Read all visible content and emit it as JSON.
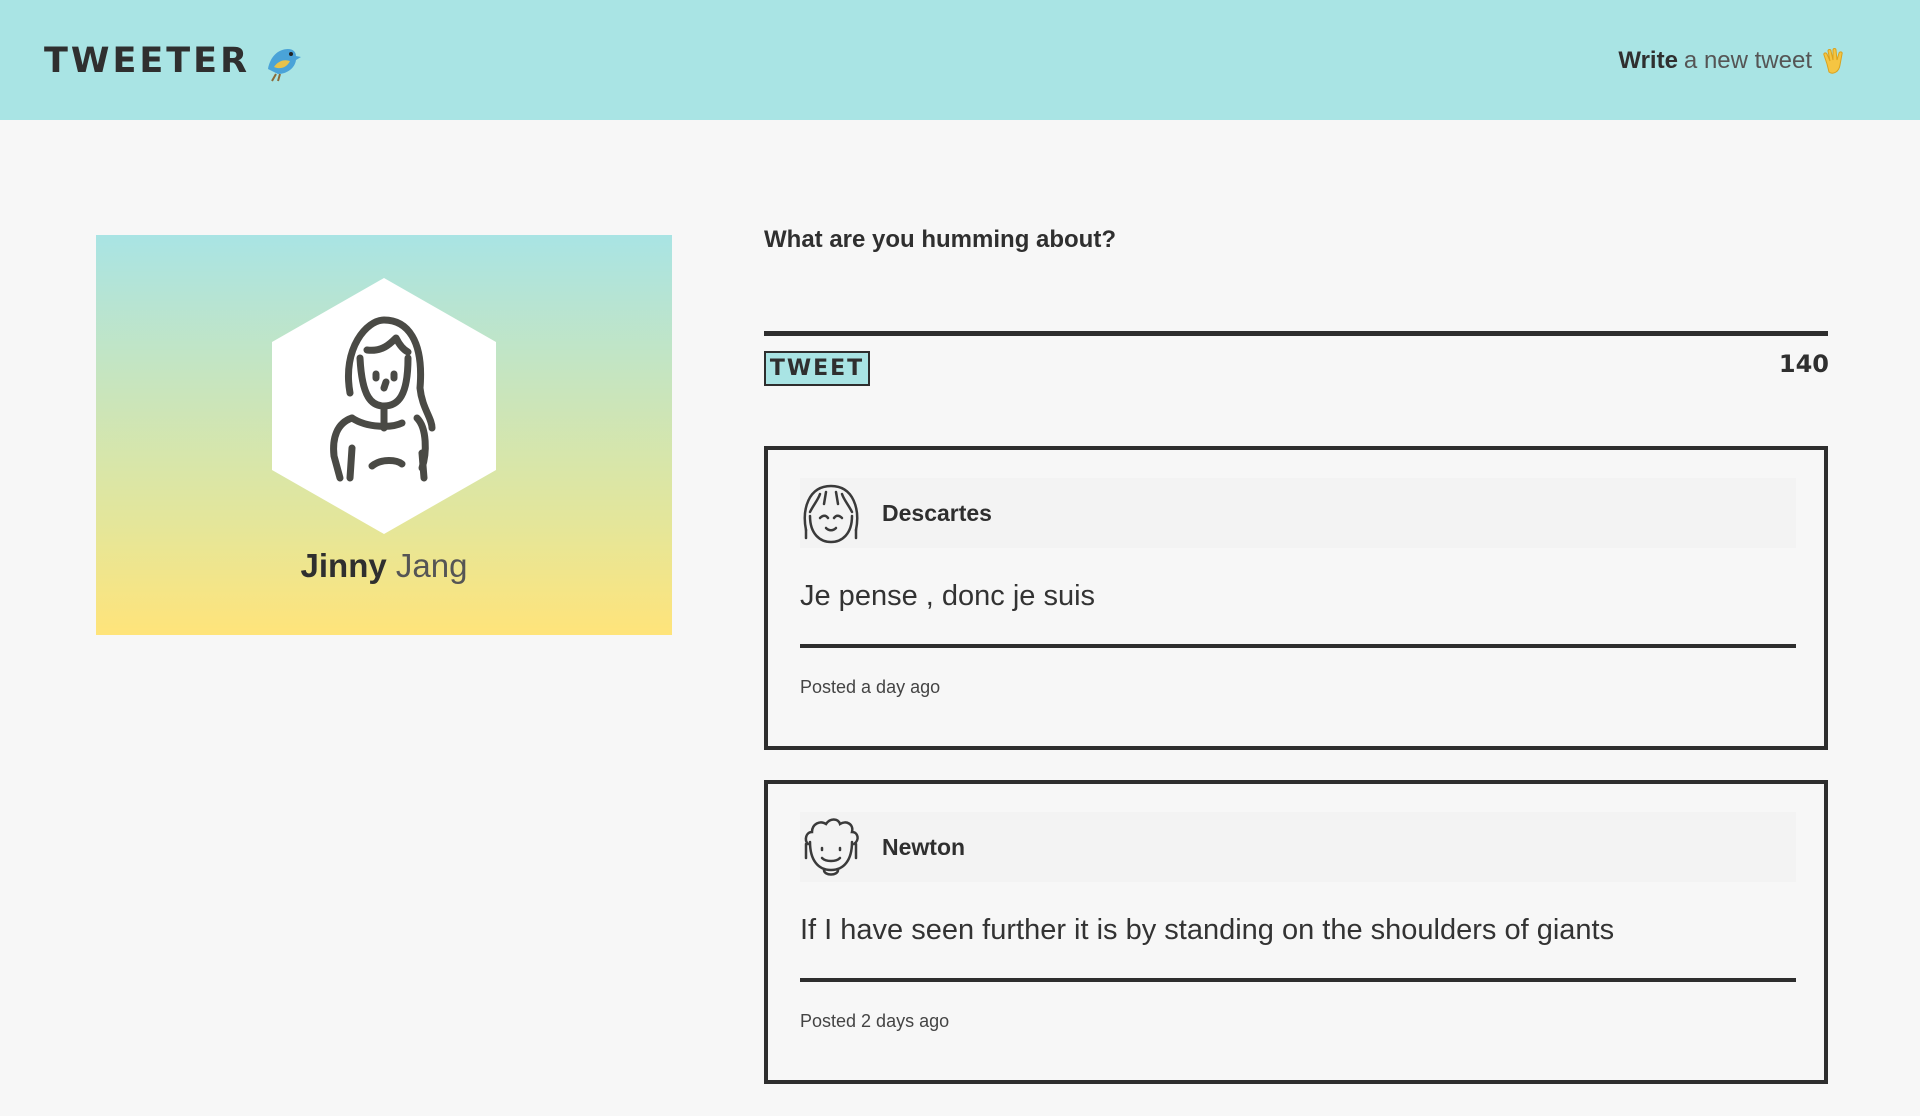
{
  "nav": {
    "brand": "TWEETER",
    "brand_icon": "bird-icon",
    "write_strong": "Write",
    "write_rest": "a new tweet",
    "write_icon": "waving-hand-icon",
    "background": "#a9e4e4"
  },
  "profile": {
    "first_name": "Jinny",
    "last_name": "Jang",
    "avatar_icon": "woman-avatar-icon",
    "gradient": [
      "#a9e4e4",
      "#e4e69a",
      "#ffe47a"
    ]
  },
  "compose": {
    "label": "What are you humming about?",
    "value": "",
    "button_label": "TWEET",
    "counter": "140"
  },
  "tweets": [
    {
      "author": "Descartes",
      "avatar_icon": "girl-face-avatar-icon",
      "content": "Je pense , donc je suis",
      "posted": "Posted a day ago"
    },
    {
      "author": "Newton",
      "avatar_icon": "curly-hair-man-avatar-icon",
      "content": "If I have seen further it is by standing on the shoulders of giants",
      "posted": "Posted 2 days ago"
    }
  ]
}
